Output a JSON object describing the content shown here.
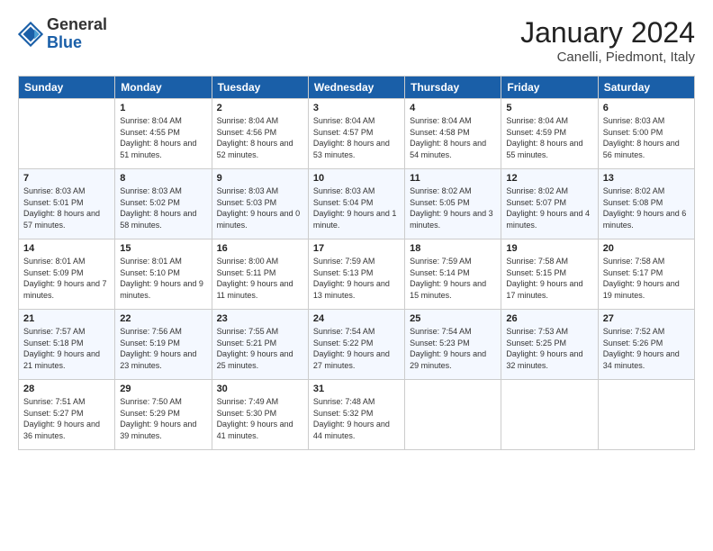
{
  "header": {
    "logo_general": "General",
    "logo_blue": "Blue",
    "month_title": "January 2024",
    "location": "Canelli, Piedmont, Italy"
  },
  "days_of_week": [
    "Sunday",
    "Monday",
    "Tuesday",
    "Wednesday",
    "Thursday",
    "Friday",
    "Saturday"
  ],
  "weeks": [
    [
      {
        "day": "",
        "sunrise": "",
        "sunset": "",
        "daylight": ""
      },
      {
        "day": "1",
        "sunrise": "Sunrise: 8:04 AM",
        "sunset": "Sunset: 4:55 PM",
        "daylight": "Daylight: 8 hours and 51 minutes."
      },
      {
        "day": "2",
        "sunrise": "Sunrise: 8:04 AM",
        "sunset": "Sunset: 4:56 PM",
        "daylight": "Daylight: 8 hours and 52 minutes."
      },
      {
        "day": "3",
        "sunrise": "Sunrise: 8:04 AM",
        "sunset": "Sunset: 4:57 PM",
        "daylight": "Daylight: 8 hours and 53 minutes."
      },
      {
        "day": "4",
        "sunrise": "Sunrise: 8:04 AM",
        "sunset": "Sunset: 4:58 PM",
        "daylight": "Daylight: 8 hours and 54 minutes."
      },
      {
        "day": "5",
        "sunrise": "Sunrise: 8:04 AM",
        "sunset": "Sunset: 4:59 PM",
        "daylight": "Daylight: 8 hours and 55 minutes."
      },
      {
        "day": "6",
        "sunrise": "Sunrise: 8:03 AM",
        "sunset": "Sunset: 5:00 PM",
        "daylight": "Daylight: 8 hours and 56 minutes."
      }
    ],
    [
      {
        "day": "7",
        "sunrise": "Sunrise: 8:03 AM",
        "sunset": "Sunset: 5:01 PM",
        "daylight": "Daylight: 8 hours and 57 minutes."
      },
      {
        "day": "8",
        "sunrise": "Sunrise: 8:03 AM",
        "sunset": "Sunset: 5:02 PM",
        "daylight": "Daylight: 8 hours and 58 minutes."
      },
      {
        "day": "9",
        "sunrise": "Sunrise: 8:03 AM",
        "sunset": "Sunset: 5:03 PM",
        "daylight": "Daylight: 9 hours and 0 minutes."
      },
      {
        "day": "10",
        "sunrise": "Sunrise: 8:03 AM",
        "sunset": "Sunset: 5:04 PM",
        "daylight": "Daylight: 9 hours and 1 minute."
      },
      {
        "day": "11",
        "sunrise": "Sunrise: 8:02 AM",
        "sunset": "Sunset: 5:05 PM",
        "daylight": "Daylight: 9 hours and 3 minutes."
      },
      {
        "day": "12",
        "sunrise": "Sunrise: 8:02 AM",
        "sunset": "Sunset: 5:07 PM",
        "daylight": "Daylight: 9 hours and 4 minutes."
      },
      {
        "day": "13",
        "sunrise": "Sunrise: 8:02 AM",
        "sunset": "Sunset: 5:08 PM",
        "daylight": "Daylight: 9 hours and 6 minutes."
      }
    ],
    [
      {
        "day": "14",
        "sunrise": "Sunrise: 8:01 AM",
        "sunset": "Sunset: 5:09 PM",
        "daylight": "Daylight: 9 hours and 7 minutes."
      },
      {
        "day": "15",
        "sunrise": "Sunrise: 8:01 AM",
        "sunset": "Sunset: 5:10 PM",
        "daylight": "Daylight: 9 hours and 9 minutes."
      },
      {
        "day": "16",
        "sunrise": "Sunrise: 8:00 AM",
        "sunset": "Sunset: 5:11 PM",
        "daylight": "Daylight: 9 hours and 11 minutes."
      },
      {
        "day": "17",
        "sunrise": "Sunrise: 7:59 AM",
        "sunset": "Sunset: 5:13 PM",
        "daylight": "Daylight: 9 hours and 13 minutes."
      },
      {
        "day": "18",
        "sunrise": "Sunrise: 7:59 AM",
        "sunset": "Sunset: 5:14 PM",
        "daylight": "Daylight: 9 hours and 15 minutes."
      },
      {
        "day": "19",
        "sunrise": "Sunrise: 7:58 AM",
        "sunset": "Sunset: 5:15 PM",
        "daylight": "Daylight: 9 hours and 17 minutes."
      },
      {
        "day": "20",
        "sunrise": "Sunrise: 7:58 AM",
        "sunset": "Sunset: 5:17 PM",
        "daylight": "Daylight: 9 hours and 19 minutes."
      }
    ],
    [
      {
        "day": "21",
        "sunrise": "Sunrise: 7:57 AM",
        "sunset": "Sunset: 5:18 PM",
        "daylight": "Daylight: 9 hours and 21 minutes."
      },
      {
        "day": "22",
        "sunrise": "Sunrise: 7:56 AM",
        "sunset": "Sunset: 5:19 PM",
        "daylight": "Daylight: 9 hours and 23 minutes."
      },
      {
        "day": "23",
        "sunrise": "Sunrise: 7:55 AM",
        "sunset": "Sunset: 5:21 PM",
        "daylight": "Daylight: 9 hours and 25 minutes."
      },
      {
        "day": "24",
        "sunrise": "Sunrise: 7:54 AM",
        "sunset": "Sunset: 5:22 PM",
        "daylight": "Daylight: 9 hours and 27 minutes."
      },
      {
        "day": "25",
        "sunrise": "Sunrise: 7:54 AM",
        "sunset": "Sunset: 5:23 PM",
        "daylight": "Daylight: 9 hours and 29 minutes."
      },
      {
        "day": "26",
        "sunrise": "Sunrise: 7:53 AM",
        "sunset": "Sunset: 5:25 PM",
        "daylight": "Daylight: 9 hours and 32 minutes."
      },
      {
        "day": "27",
        "sunrise": "Sunrise: 7:52 AM",
        "sunset": "Sunset: 5:26 PM",
        "daylight": "Daylight: 9 hours and 34 minutes."
      }
    ],
    [
      {
        "day": "28",
        "sunrise": "Sunrise: 7:51 AM",
        "sunset": "Sunset: 5:27 PM",
        "daylight": "Daylight: 9 hours and 36 minutes."
      },
      {
        "day": "29",
        "sunrise": "Sunrise: 7:50 AM",
        "sunset": "Sunset: 5:29 PM",
        "daylight": "Daylight: 9 hours and 39 minutes."
      },
      {
        "day": "30",
        "sunrise": "Sunrise: 7:49 AM",
        "sunset": "Sunset: 5:30 PM",
        "daylight": "Daylight: 9 hours and 41 minutes."
      },
      {
        "day": "31",
        "sunrise": "Sunrise: 7:48 AM",
        "sunset": "Sunset: 5:32 PM",
        "daylight": "Daylight: 9 hours and 44 minutes."
      },
      {
        "day": "",
        "sunrise": "",
        "sunset": "",
        "daylight": ""
      },
      {
        "day": "",
        "sunrise": "",
        "sunset": "",
        "daylight": ""
      },
      {
        "day": "",
        "sunrise": "",
        "sunset": "",
        "daylight": ""
      }
    ]
  ]
}
